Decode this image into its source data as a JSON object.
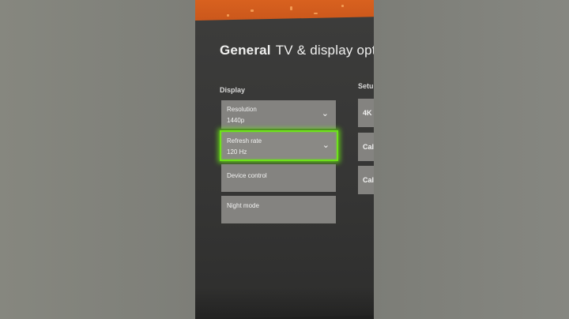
{
  "header": {
    "tab_general": "General",
    "tab_current": "TV & display optic"
  },
  "display_section": {
    "title": "Display",
    "items": [
      {
        "label": "Resolution",
        "value": "1440p"
      },
      {
        "label": "Refresh rate",
        "value": "120 Hz"
      },
      {
        "label": "Device control",
        "value": ""
      },
      {
        "label": "Night mode",
        "value": ""
      }
    ]
  },
  "setup_section": {
    "title": "Setu",
    "items": [
      {
        "label": "4K"
      },
      {
        "label": "Cal"
      },
      {
        "label": "Cal"
      }
    ]
  },
  "colors": {
    "focus_glow": "#6ee21a",
    "tile": "#848380",
    "background": "#353534",
    "wall": "#d8611f"
  },
  "icons": {
    "dropdown": "chevron-down-icon"
  }
}
